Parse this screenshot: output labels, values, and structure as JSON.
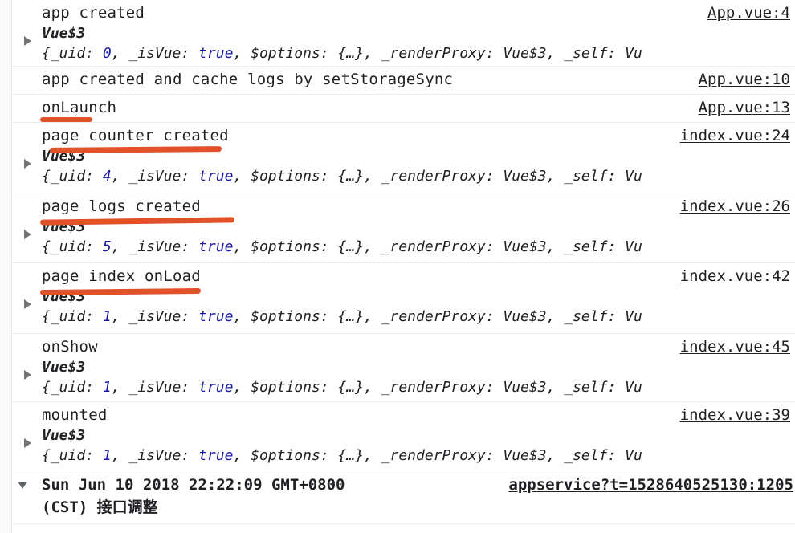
{
  "panel": {
    "name": "devtools-console",
    "truncated_suffix": "Vu"
  },
  "object_preview": {
    "constructor": "Vue$3",
    "prefix": "{_uid: ",
    "mid1": ", _isVue: ",
    "bool": "true",
    "mid2": ", $options: {…}, _renderProxy: Vue$3, _self: ",
    "tail": "Vu"
  },
  "messages": [
    {
      "text": "app created",
      "link": "App.vue:4",
      "has_object": true,
      "uid": "0",
      "annotated": false
    },
    {
      "text": "app created and cache logs by setStorageSync",
      "link": "App.vue:10",
      "has_object": false,
      "uid": "",
      "annotated": false
    },
    {
      "text": "onLaunch",
      "link": "App.vue:13",
      "has_object": false,
      "uid": "",
      "annotated": true
    },
    {
      "text": "page counter created",
      "link": "index.vue:24",
      "has_object": true,
      "uid": "4",
      "annotated": true
    },
    {
      "text": "page logs created",
      "link": "index.vue:26",
      "has_object": true,
      "uid": "5",
      "annotated": true
    },
    {
      "text": "page index onLoad",
      "link": "index.vue:42",
      "has_object": true,
      "uid": "1",
      "annotated": true
    },
    {
      "text": "onShow",
      "link": "index.vue:45",
      "has_object": true,
      "uid": "1",
      "annotated": false
    },
    {
      "text": "mounted",
      "link": "index.vue:39",
      "has_object": true,
      "uid": "1",
      "annotated": false
    }
  ],
  "group": {
    "timestamp": "Sun Jun 10 2018 22:22:09 GMT+0800",
    "link": "appservice?t=1528640525130:1205",
    "subtitle": "(CST) 接口调整"
  },
  "colors": {
    "annotation": "#e2522a",
    "value_blue": "#1a1aa6",
    "text": "#202124",
    "row_border": "#ececec",
    "gutter": "#fafafa"
  }
}
